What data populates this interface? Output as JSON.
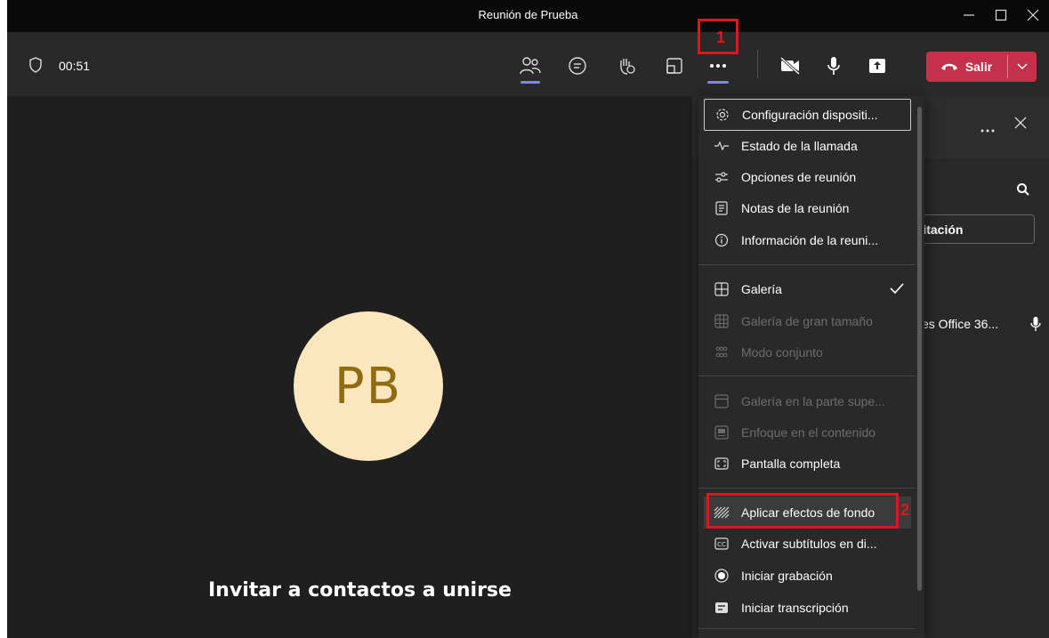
{
  "window": {
    "title": "Reunión de Prueba",
    "controls": [
      "minimize",
      "maximize",
      "close"
    ]
  },
  "toolbar": {
    "timer": "00:51",
    "left_icon": "shield-icon",
    "icons": [
      "people-icon",
      "chat-icon",
      "raise-hand-icon",
      "rooms-icon",
      "more-icon",
      "camera-off-icon",
      "mic-icon",
      "share-icon"
    ],
    "leave_label": "Salir"
  },
  "stage": {
    "avatar_initials": "PB",
    "invite_text": "Invitar a contactos a unirse"
  },
  "panel": {
    "invite_button_partial": "nvitación",
    "participant_partial": "es Office 36..."
  },
  "menu": {
    "items": [
      {
        "label": "Configuración dispositi...",
        "icon": "gear-icon",
        "state": "focused"
      },
      {
        "label": "Estado de la llamada",
        "icon": "pulse-icon",
        "state": "normal"
      },
      {
        "label": "Opciones de reunión",
        "icon": "sliders-icon",
        "state": "normal"
      },
      {
        "label": "Notas de la reunión",
        "icon": "notes-icon",
        "state": "normal"
      },
      {
        "label": "Información de la reuni...",
        "icon": "info-icon",
        "state": "normal"
      },
      {
        "label": "Galería",
        "icon": "gallery-icon",
        "state": "checked"
      },
      {
        "label": "Galería de gran tamaño",
        "icon": "large-gallery-icon",
        "state": "disabled"
      },
      {
        "label": "Modo conjunto",
        "icon": "together-mode-icon",
        "state": "disabled"
      },
      {
        "label": "Galería en la parte supe...",
        "icon": "gallery-top-icon",
        "state": "disabled"
      },
      {
        "label": "Enfoque en el contenido",
        "icon": "focus-content-icon",
        "state": "disabled"
      },
      {
        "label": "Pantalla completa",
        "icon": "fullscreen-icon",
        "state": "normal"
      },
      {
        "label": "Aplicar efectos de fondo",
        "icon": "background-effects-icon",
        "state": "hovered"
      },
      {
        "label": "Activar subtítulos en di...",
        "icon": "captions-icon",
        "state": "normal"
      },
      {
        "label": "Iniciar grabación",
        "icon": "record-icon",
        "state": "normal"
      },
      {
        "label": "Iniciar transcripción",
        "icon": "transcript-icon",
        "state": "normal"
      }
    ]
  },
  "annotations": {
    "step1": "1",
    "step2": "2",
    "color": "#e0161d"
  },
  "colors": {
    "accent": "#7f85f5",
    "leave": "#c4314b",
    "avatar_bg": "#fbe6bd",
    "avatar_text": "#8f6b13"
  }
}
